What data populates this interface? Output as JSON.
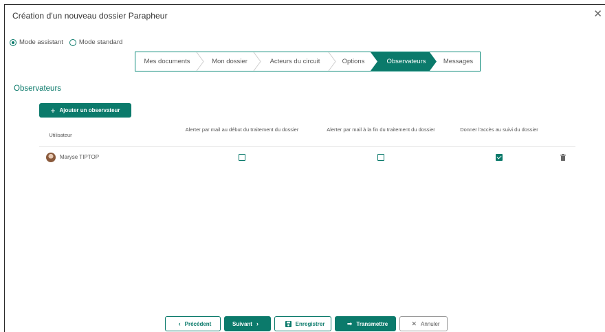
{
  "dialog": {
    "title": "Création d'un nouveau dossier Parapheur",
    "close_icon": "close-icon"
  },
  "modes": [
    {
      "label": "Mode assistant",
      "selected": true
    },
    {
      "label": "Mode standard",
      "selected": false
    }
  ],
  "steps": [
    {
      "label": "Mes documents",
      "active": false
    },
    {
      "label": "Mon dossier",
      "active": false
    },
    {
      "label": "Acteurs du circuit",
      "active": false
    },
    {
      "label": "Options",
      "active": false
    },
    {
      "label": "Observateurs",
      "active": true
    },
    {
      "label": "Messages",
      "active": false
    }
  ],
  "section": {
    "title": "Observateurs",
    "add_button": "Ajouter un observateur"
  },
  "table": {
    "headers": [
      "Utilisateur",
      "Alerter par mail au début du traitement du dossier",
      "Alerter par mail à la fin du traitement du dossier",
      "Donner l'accès au suivi du dossier"
    ],
    "rows": [
      {
        "user": "Maryse TIPTOP",
        "alert_start": false,
        "alert_end": false,
        "follow_access": true
      }
    ]
  },
  "footer": {
    "previous": "Précédent",
    "next": "Suivant",
    "save": "Enregistrer",
    "send": "Transmettre",
    "cancel": "Annuler"
  },
  "colors": {
    "accent": "#0b7a6b"
  }
}
